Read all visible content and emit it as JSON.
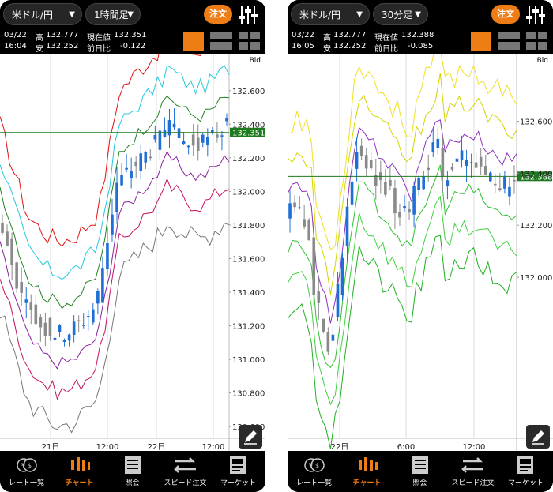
{
  "phones": [
    {
      "pair": "米ドル/円",
      "timeframe": "1時間足",
      "order_label": "注文",
      "date": "03/22",
      "time": "16:04",
      "high_label": "高",
      "high": "132.777",
      "low_label": "安",
      "low": "132.252",
      "current_label": "現在値",
      "current": "132.351",
      "change_label": "前日比",
      "change": "-0.122",
      "bid_label": "Bid",
      "price_ticks": [
        "132.600",
        "132.400",
        "132.200",
        "132.000",
        "131.800",
        "131.600",
        "131.400",
        "131.200",
        "131.000",
        "130.800",
        "130.600"
      ],
      "price_tag": "132.351",
      "x_ticks": [
        "21日",
        "12:00",
        "22日",
        "12:00"
      ]
    },
    {
      "pair": "米ドル/円",
      "timeframe": "30分足",
      "order_label": "注文",
      "date": "03/22",
      "time": "16:05",
      "high_label": "高",
      "high": "132.777",
      "low_label": "安",
      "low": "132.252",
      "current_label": "現在値",
      "current": "132.388",
      "change_label": "前日比",
      "change": "-0.085",
      "bid_label": "Bid",
      "price_ticks": [
        "132.600",
        "132.400",
        "132.200",
        "132.000"
      ],
      "price_tag": "132.388",
      "x_ticks": [
        "22日",
        "6:00",
        "12:00"
      ]
    }
  ],
  "tabs": [
    "レート一覧",
    "チャート",
    "照会",
    "スピード注文",
    "マーケット"
  ],
  "active_tab": "チャート",
  "colors": {
    "accent": "#ef7d16",
    "current_line": "#1e7a1e",
    "bull": "#1f6fd6",
    "bear": "#8a8a8a"
  }
}
